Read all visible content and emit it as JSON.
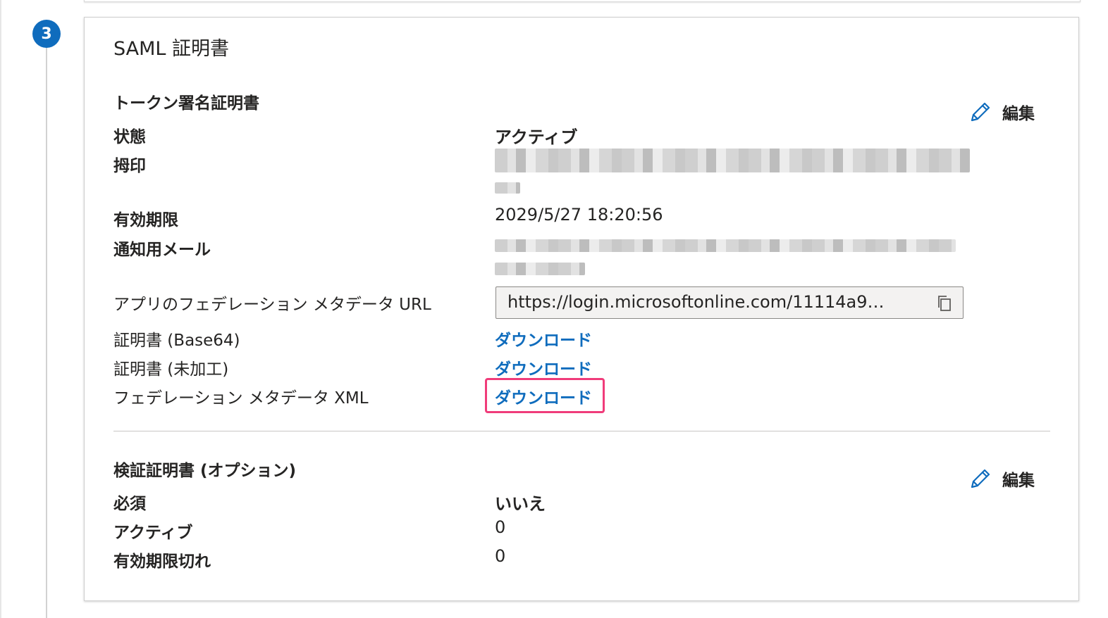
{
  "step": {
    "number": "3"
  },
  "card": {
    "title": "SAML 証明書"
  },
  "token_signing": {
    "title": "トークン署名証明書",
    "edit_label": "編集",
    "fields": {
      "status_label": "状態",
      "status_value": "アクティブ",
      "thumbprint_label": "拇印",
      "expiry_label": "有効期限",
      "expiry_value": "2029/5/27 18:20:56",
      "notify_label": "通知用メール",
      "metadata_url_label": "アプリのフェデレーション メタデータ URL",
      "metadata_url_value": "https://login.microsoftonline.com/11114a9…",
      "cert_base64_label": "証明書 (Base64)",
      "cert_base64_link": "ダウンロード",
      "cert_raw_label": "証明書 (未加工)",
      "cert_raw_link": "ダウンロード",
      "federation_xml_label": "フェデレーション メタデータ XML",
      "federation_xml_link": "ダウンロード"
    }
  },
  "verification": {
    "title": "検証証明書 (オプション)",
    "edit_label": "編集",
    "required_label": "必須",
    "required_value": "いいえ",
    "active_label": "アクティブ",
    "active_value": "0",
    "expired_label": "有効期限切れ",
    "expired_value": "0"
  },
  "colors": {
    "accent": "#0f6cbd",
    "highlight": "#f03c7a"
  },
  "icons": {
    "edit": "pencil-icon",
    "copy": "copy-icon"
  }
}
